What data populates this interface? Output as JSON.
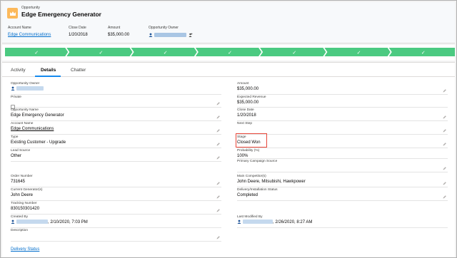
{
  "header": {
    "object_type": "Opportunity",
    "title": "Edge Emergency Generator",
    "fields": [
      {
        "label": "Account Name",
        "value": "Edge Communications"
      },
      {
        "label": "Close Date",
        "value": "1/20/2018"
      },
      {
        "label": "Amount",
        "value": "$35,000.00"
      },
      {
        "label": "Opportunity Owner",
        "value": ""
      }
    ],
    "icon": "crown-icon"
  },
  "path": {
    "steps_completed": 7,
    "check_glyph": "✓"
  },
  "tabs": [
    {
      "label": "Activity"
    },
    {
      "label": "Details"
    },
    {
      "label": "Chatter"
    }
  ],
  "left_fields": {
    "owner": {
      "label": "Opportunity Owner",
      "value": ""
    },
    "private": {
      "label": "Private"
    },
    "name": {
      "label": "Opportunity Name",
      "value": "Edge Emergency Generator"
    },
    "account": {
      "label": "Account Name",
      "value": "Edge Communications"
    },
    "type": {
      "label": "Type",
      "value": "Existing Customer - Upgrade"
    },
    "lead_source": {
      "label": "Lead Source",
      "value": "Other"
    },
    "order_number": {
      "label": "Order Number",
      "value": "731645"
    },
    "current_generators": {
      "label": "Current Generator(s)",
      "value": "John Deere"
    },
    "tracking_number": {
      "label": "Tracking Number",
      "value": "830150301420"
    },
    "created_by": {
      "label": "Created By",
      "value": ", 2/10/2020, 7:03 PM"
    },
    "description": {
      "label": "Description",
      "value": ""
    }
  },
  "right_fields": {
    "amount": {
      "label": "Amount",
      "value": "$35,000.00"
    },
    "expected_revenue": {
      "label": "Expected Revenue",
      "value": "$35,000.00"
    },
    "close_date": {
      "label": "Close Date",
      "value": "1/20/2018"
    },
    "next_step": {
      "label": "Next Step",
      "value": ""
    },
    "stage": {
      "label": "Stage",
      "value": "Closed Won"
    },
    "probability": {
      "label": "Probability (%)",
      "value": "100%"
    },
    "primary_campaign": {
      "label": "Primary Campaign Source",
      "value": ""
    },
    "main_competitors": {
      "label": "Main Competitor(s)",
      "value": "John Deere, Mitsubishi, Hawkpower"
    },
    "delivery_status": {
      "label": "Delivery/Installation Status",
      "value": "Completed"
    },
    "last_modified": {
      "label": "Last Modified By",
      "value": ", 2/26/2020, 8:27 AM"
    }
  },
  "section_link": "Delivery Status",
  "colors": {
    "path_complete": "#4bca81",
    "highlight": "#e8473a",
    "link": "#006dcc",
    "icon_bg": "#fcb95b"
  }
}
